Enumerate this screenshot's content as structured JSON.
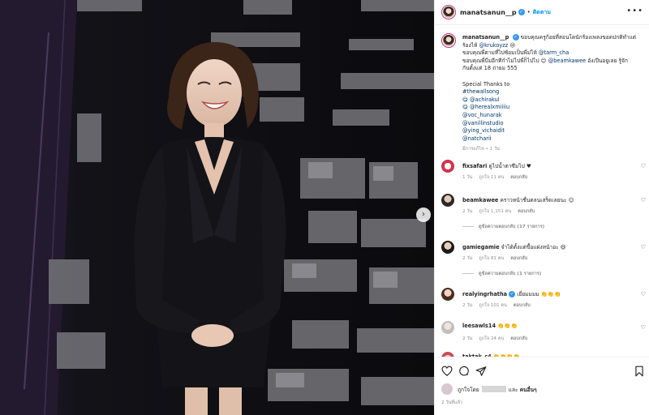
{
  "header": {
    "username": "manatsanun__p",
    "separator": "•",
    "follow_label": "ติดตาม",
    "more_icon": "more-horizontal-icon"
  },
  "caption": {
    "username": "manatsanun__p",
    "line1": "ขอบคุณครูก้อยที่สอนโดนักร้องเพลงขอดปกติทำแต่",
    "line2_text": "ร้องไห้ ",
    "line2_mention": "@krukoyzz",
    "line3_text": "ขอบคุณพี่ตามที่ไปซ้อมเป็นพี่ม่ไห้ ",
    "line3_mention": "@tarm_cha",
    "line4_text": "ขอบคุณพี่บีมอีกทีกำไม่ไปพี่ก็ไปไป ",
    "line4_mention": "@beamkawee",
    "line4_tail": " อังเปีนอยูเลย รู้จัก",
    "line5": "กันตั้งแต่ 18 ถ่ายม 555",
    "special": "Special Thanks to",
    "hashtag": "#thewallsong",
    "mentions": [
      "@achirakul",
      "@herealxmiiiiu",
      "@voc_hunarak",
      "@vanillinstudio",
      "@ying_vichaidit",
      "@natcharii"
    ],
    "time": "มีการแก้ไข • 1 วัน"
  },
  "comments": [
    {
      "username": "fixsafari",
      "text": " ดูไปน้ำตาซึมไป ♥",
      "meta": [
        "1 วัน",
        "ถูกใจ 11 คน",
        "ตอบกลับ"
      ],
      "replies": ""
    },
    {
      "username": "beamkawee",
      "text": " คราวหน้าชื่นตลนเสร็ดเลยนะ 😊",
      "meta": [
        "2 วัน",
        "ถูกใจ 1,151 คน",
        "ตอบกลับ"
      ],
      "replies": "ดูข้อความตอบกลับ (17 รายการ)"
    },
    {
      "username": "gamiegamie",
      "text": " จำได้ตั้งแต่ขื้อแผ่งหน้าอะ 😄",
      "meta": [
        "2 วัน",
        "ถูกใจ 81 คน",
        "ตอบกลับ"
      ],
      "replies": "ดูข้อความตอบกลับ (1 รายการ)"
    },
    {
      "username": "realyingrhatha",
      "text": " เยี่ยมมมม 👏👏👏",
      "meta": [
        "2 วัน",
        "ถูกใจ 101 คน",
        "ตอบกลับ"
      ],
      "replies": ""
    },
    {
      "username": "leesawls14",
      "text": " 👏👏👏",
      "meta": [
        "2 วัน",
        "ถูกใจ 24 คน",
        "ตอบกลับ"
      ],
      "replies": ""
    },
    {
      "username": "taktak_c4",
      "text": " 👏👏👏👏",
      "meta": [
        "",
        "",
        ""
      ],
      "replies": ""
    }
  ],
  "actions": {
    "like_icon": "heart-icon",
    "comment_icon": "comment-icon",
    "share_icon": "send-icon",
    "save_icon": "bookmark-icon"
  },
  "likes": {
    "prefix": "ถูกใจโดย",
    "and": "และ",
    "others": "คนอื่นๆ"
  },
  "post_date": "2 วันที่แล้ว",
  "colors": {
    "link": "#00376b",
    "follow": "#0095f6",
    "verified": "#3897f0",
    "muted": "#8e8e8e"
  }
}
